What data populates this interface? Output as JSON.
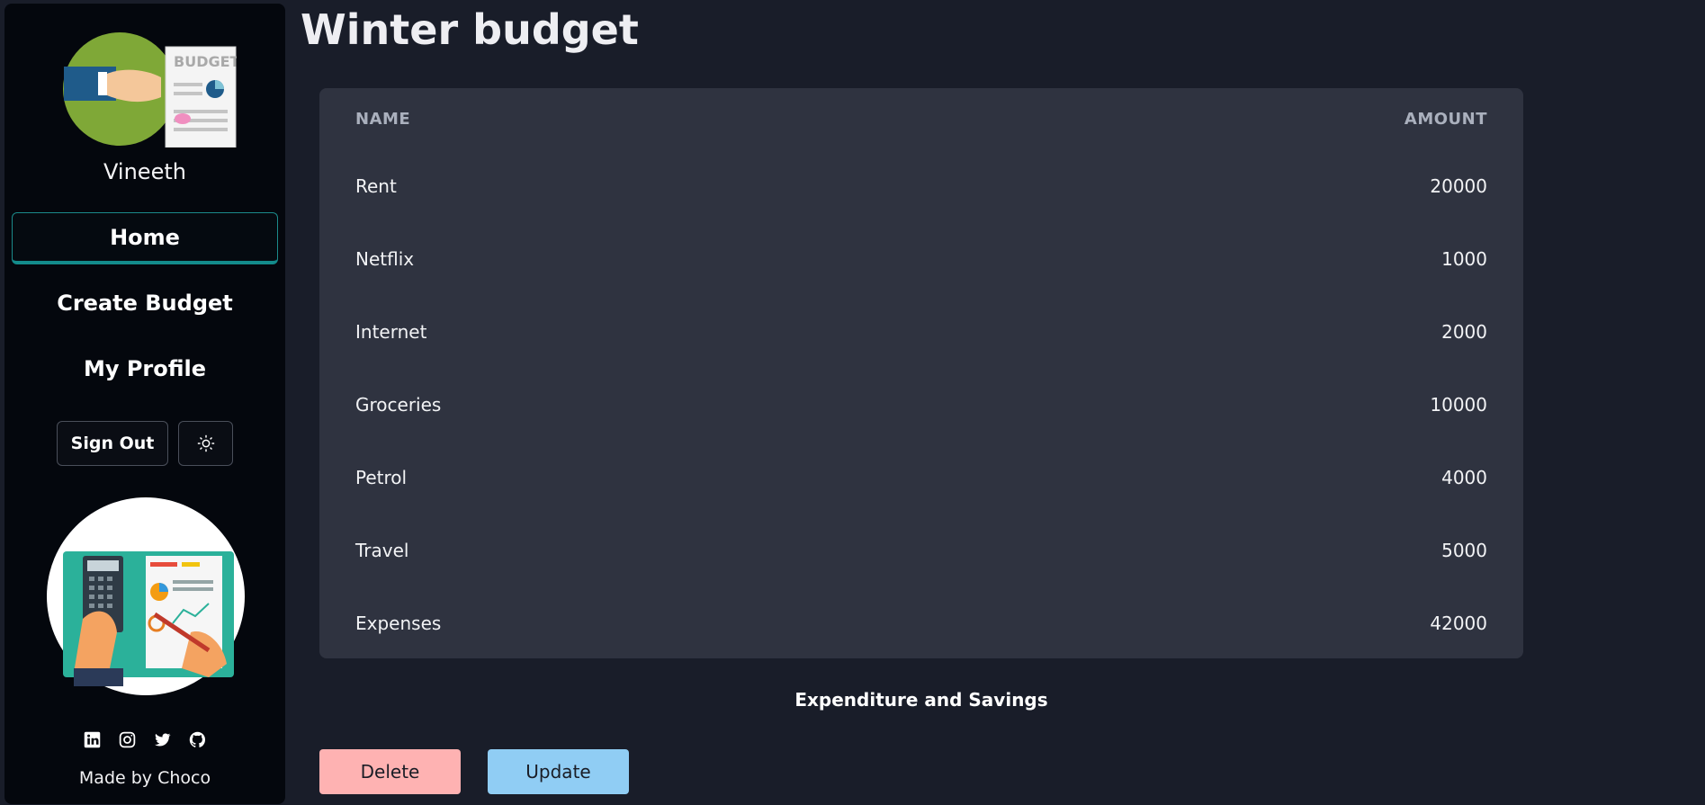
{
  "sidebar": {
    "username": "Vineeth",
    "logo_text": "BUDGET",
    "nav": [
      {
        "label": "Home",
        "active": true
      },
      {
        "label": "Create Budget",
        "active": false
      },
      {
        "label": "My Profile",
        "active": false
      }
    ],
    "sign_out_label": "Sign Out",
    "theme_toggle_icon": "sun-icon",
    "socials": [
      "linkedin-icon",
      "instagram-icon",
      "twitter-icon",
      "github-icon"
    ],
    "made_by": "Made by Choco"
  },
  "main": {
    "title": "Winter budget",
    "table": {
      "headers": {
        "name": "NAME",
        "amount": "AMOUNT"
      },
      "rows": [
        {
          "name": "Rent",
          "amount": "20000"
        },
        {
          "name": "Netflix",
          "amount": "1000"
        },
        {
          "name": "Internet",
          "amount": "2000"
        },
        {
          "name": "Groceries",
          "amount": "10000"
        },
        {
          "name": "Petrol",
          "amount": "4000"
        },
        {
          "name": "Travel",
          "amount": "5000"
        },
        {
          "name": "Expenses",
          "amount": "42000"
        }
      ]
    },
    "caption": "Expenditure and Savings",
    "delete_label": "Delete",
    "update_label": "Update"
  },
  "colors": {
    "background": "#191d29",
    "sidebar": "#04070d",
    "accent": "#138b8b",
    "table_bg": "#2f3340",
    "delete_btn": "#feb2b2",
    "update_btn": "#90cdf4"
  }
}
